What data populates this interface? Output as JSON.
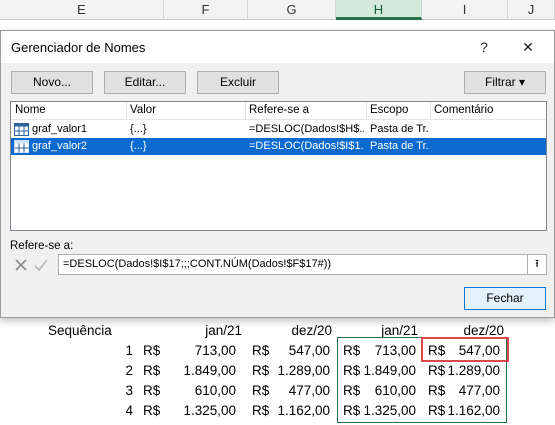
{
  "sheet": {
    "columns": [
      "E",
      "F",
      "G",
      "H",
      "I",
      "J"
    ],
    "selected_column": "H",
    "header_row": {
      "label": "Sequência",
      "cols": [
        "jan/21",
        "dez/20",
        "jan/21",
        "dez/20"
      ]
    },
    "rows": [
      {
        "n": "1",
        "cur1": "R$",
        "v1": "713,00",
        "cur2": "R$",
        "v2": "547,00",
        "cur3": "R$",
        "v3": "713,00",
        "cur4": "R$",
        "v4": "547,00"
      },
      {
        "n": "2",
        "cur1": "R$",
        "v1": "1.849,00",
        "cur2": "R$",
        "v2": "1.289,00",
        "cur3": "R$",
        "v3": "1.849,00",
        "cur4": "R$",
        "v4": "1.289,00"
      },
      {
        "n": "3",
        "cur1": "R$",
        "v1": "610,00",
        "cur2": "R$",
        "v2": "477,00",
        "cur3": "R$",
        "v3": "610,00",
        "cur4": "R$",
        "v4": "477,00"
      },
      {
        "n": "4",
        "cur1": "R$",
        "v1": "1.325,00",
        "cur2": "R$",
        "v2": "1.162,00",
        "cur3": "R$",
        "v3": "1.325,00",
        "cur4": "R$",
        "v4": "1.162,00"
      }
    ]
  },
  "dialog": {
    "title": "Gerenciador de Nomes",
    "help": "?",
    "close": "✕",
    "buttons": {
      "new": "Novo...",
      "edit": "Editar...",
      "delete": "Excluir",
      "filter": "Filtrar ▾",
      "close": "Fechar"
    },
    "columns": [
      "Nome",
      "Valor",
      "Refere-se a",
      "Escopo",
      "Comentário"
    ],
    "names": [
      {
        "name": "graf_valor1",
        "value": "{...}",
        "refers": "=DESLOC(Dados!$H$...",
        "scope": "Pasta de Tr...",
        "comment": "",
        "selected": false
      },
      {
        "name": "graf_valor2",
        "value": "{...}",
        "refers": "=DESLOC(Dados!$I$1...",
        "scope": "Pasta de Tr...",
        "comment": "",
        "selected": true
      }
    ],
    "refers_label": "Refere-se a:",
    "refers_value": "=DESLOC(Dados!$I$17;;;CONT.NÚM(Dados!$F$17#))",
    "collapse_icon": "⭱"
  }
}
